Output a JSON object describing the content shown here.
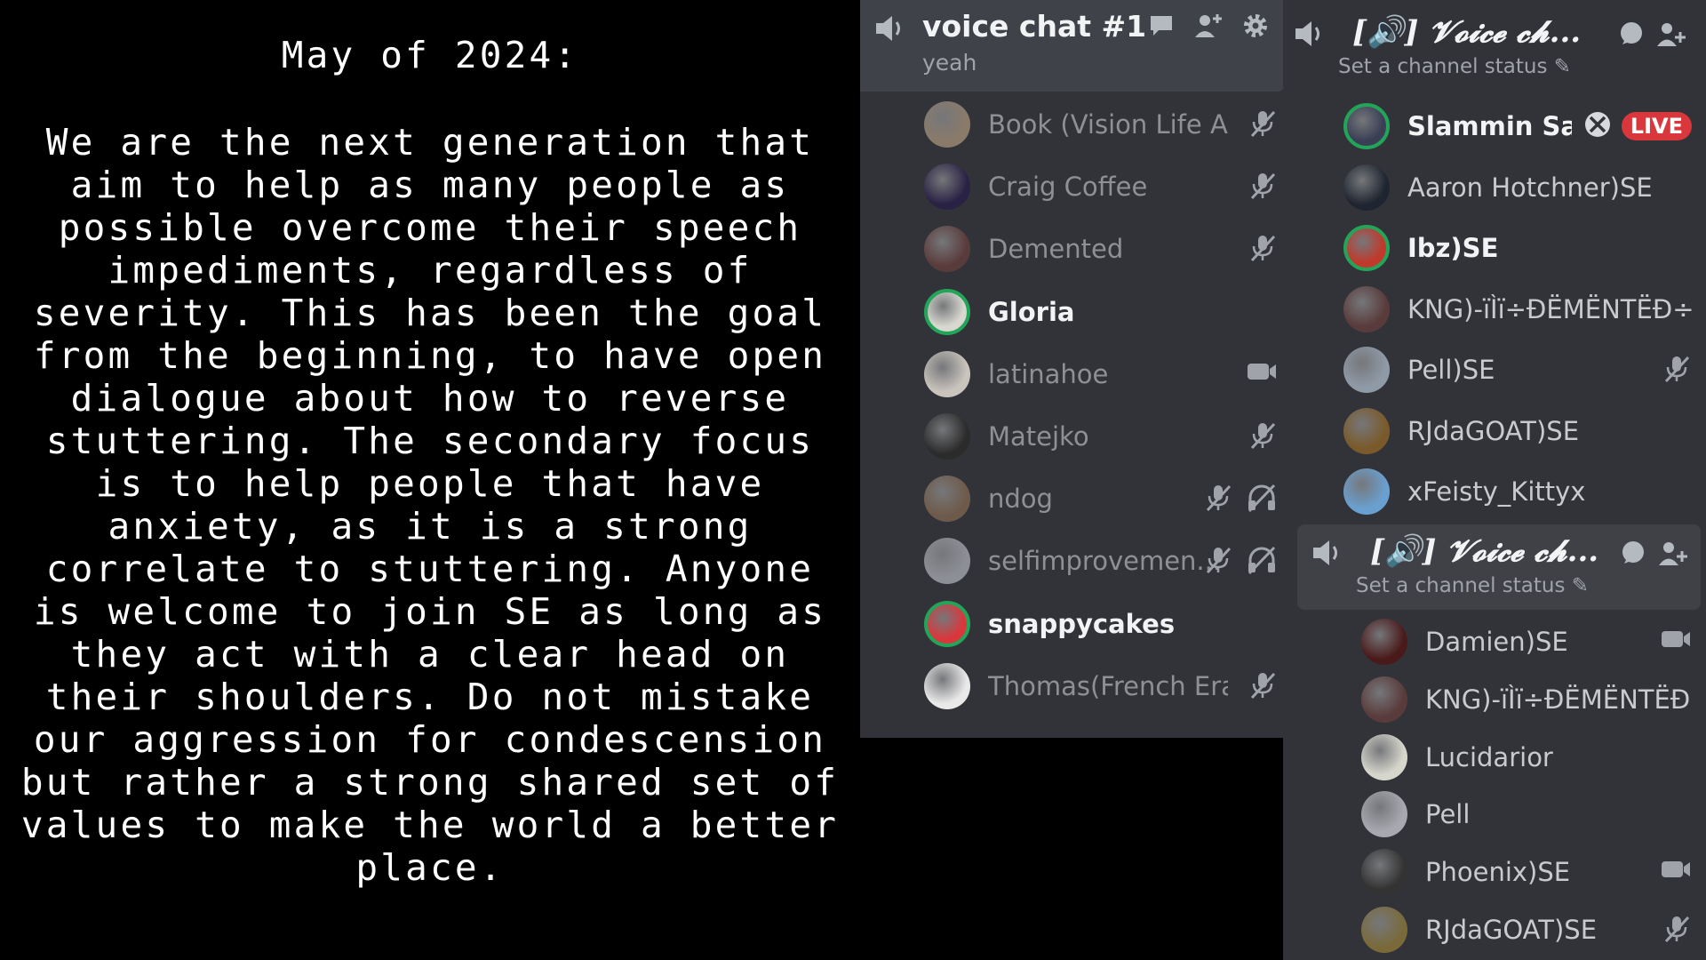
{
  "statement": {
    "heading": "May of 2024:",
    "body": "We are the next generation that aim to help as many people as possible overcome their speech impediments, regardless of severity. This has been the goal from the beginning, to have open dialogue about how to reverse stuttering. The secondary focus is to help people that have anxiety, as it is a strong correlate to stuttering. Anyone is welcome to join SE as long as they act with a clear head on their shoulders. Do not mistake our aggression for condescension but rather a strong shared set of values to make the world a better place."
  },
  "voice_chat_1": {
    "name": "voice chat #1",
    "status": "yeah",
    "members": [
      {
        "name": "Book (Vision Life A...",
        "icons": [
          "mic-muted-icon"
        ]
      },
      {
        "name": "Craig Coffee",
        "icons": [
          "mic-muted-icon"
        ]
      },
      {
        "name": "Demented",
        "icons": [
          "mic-muted-icon"
        ]
      },
      {
        "name": "Gloria",
        "icons": []
      },
      {
        "name": "latinahoe",
        "icons": [
          "video-camera-icon"
        ]
      },
      {
        "name": "Matejko",
        "icons": [
          "mic-muted-icon"
        ]
      },
      {
        "name": "ndog",
        "icons": [
          "mic-muted-icon",
          "headset-deafened-icon"
        ]
      },
      {
        "name": "selfimprovemen...",
        "icons": [
          "mic-muted-icon",
          "headset-deafened-icon"
        ]
      },
      {
        "name": "snappycakes",
        "icons": []
      },
      {
        "name": "Thomas(French Era)",
        "icons": [
          "mic-muted-icon"
        ]
      }
    ]
  },
  "voice_channel_a": {
    "name": "[🔊] 𝓥𝓸𝓲𝓬𝓮 𝓬𝓱...",
    "status": "Set a channel status",
    "members": [
      {
        "name": "Slammin Sa...",
        "badge": "LIVE"
      },
      {
        "name": "Aaron Hotchner)SE"
      },
      {
        "name": "Ibz)SE"
      },
      {
        "name": "KNG)-ïÌï÷ĐËMËNTËĐ÷..."
      },
      {
        "name": "Pell)SE"
      },
      {
        "name": "RJdaGOAT)SE"
      },
      {
        "name": "xFeisty_Kittyx"
      }
    ]
  },
  "voice_channel_b": {
    "name": "[🔊] 𝓥𝓸𝓲𝓬𝓮 𝓬𝓱...",
    "status": "Set a channel status",
    "members": [
      {
        "name": "Damien)SE"
      },
      {
        "name": "KNG)-ïÌï÷ĐËMËNTËĐ÷..."
      },
      {
        "name": "Lucidarior"
      },
      {
        "name": "Pell"
      },
      {
        "name": "Phoenix)SE"
      },
      {
        "name": "RJdaGOAT)SE"
      }
    ]
  },
  "colors": {
    "speaking_ring": "#23a559",
    "live_badge": "#da373c",
    "panel_bg": "#313338"
  }
}
